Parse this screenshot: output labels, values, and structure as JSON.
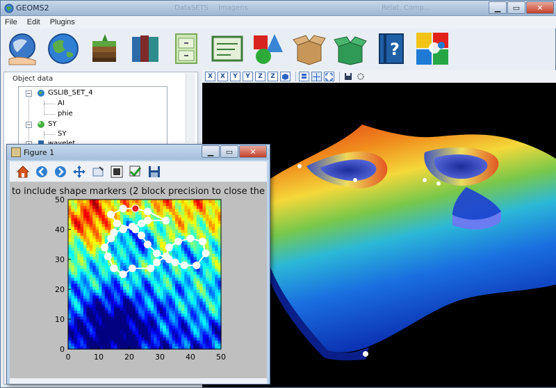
{
  "app": {
    "title": "GEOMS2",
    "ghost_tabs": [
      "DataSETS",
      "Imagens",
      "Relat. Comp..."
    ]
  },
  "menu": [
    "File",
    "Edit",
    "Plugins"
  ],
  "toolbar_icons": [
    "world-hand-icon",
    "globe-icon",
    "layers-icon",
    "books-icon",
    "cabinet-icon",
    "board-icon",
    "shapes-icon",
    "box-open-icon",
    "box-green-icon",
    "help-book-icon",
    "puzzle-icon"
  ],
  "left_panel": {
    "title": "Object data",
    "tree": [
      {
        "label": "GSLIB_SET_4",
        "level": 0,
        "expander": "-"
      },
      {
        "label": "AI",
        "level": 1
      },
      {
        "label": "phie",
        "level": 1
      },
      {
        "label": "SY",
        "level": 0,
        "expander": "-"
      },
      {
        "label": "SY",
        "level": 1
      },
      {
        "label": "wavelet",
        "level": 0,
        "expander": "+"
      }
    ]
  },
  "viewer_toolbar": {
    "buttons": [
      "X",
      "X",
      "Y",
      "Y",
      "Z",
      "Z"
    ]
  },
  "figure": {
    "title": "Figure 1",
    "plot_title": "to include shape markers (2 block precision to close the"
  },
  "chart_data": {
    "type": "heatmap",
    "title": "to include shape markers (2 block precision to close the",
    "xlim": [
      0,
      50
    ],
    "ylim": [
      0,
      50
    ],
    "xticks": [
      0,
      10,
      20,
      30,
      40,
      50
    ],
    "yticks": [
      0,
      10,
      20,
      30,
      40,
      50
    ],
    "colormap": "jet",
    "series": [
      {
        "type": "line-with-markers",
        "marker_color": "#ffffff",
        "points": [
          [
            14,
            45
          ],
          [
            18,
            47
          ],
          [
            22,
            47
          ],
          [
            26,
            46
          ],
          [
            32,
            43
          ],
          [
            26,
            43
          ],
          [
            24,
            42
          ],
          [
            21,
            41
          ],
          [
            18,
            40
          ],
          [
            15,
            39
          ],
          [
            14,
            37
          ],
          [
            12,
            34
          ],
          [
            13,
            31
          ],
          [
            15,
            27
          ],
          [
            18,
            25
          ],
          [
            21,
            27
          ],
          [
            27,
            27
          ],
          [
            29,
            29
          ],
          [
            32,
            31
          ],
          [
            33,
            34
          ],
          [
            36,
            36
          ],
          [
            40,
            37
          ],
          [
            44,
            36
          ],
          [
            45,
            32
          ],
          [
            42,
            28
          ],
          [
            38,
            28
          ],
          [
            35,
            29
          ],
          [
            33,
            30
          ],
          [
            29,
            32
          ],
          [
            26,
            35
          ],
          [
            24,
            38
          ],
          [
            22,
            40
          ],
          [
            16,
            42
          ],
          [
            14,
            45
          ]
        ]
      }
    ],
    "selected_marker": [
      22,
      47
    ],
    "selected_marker_color": "#e8222a"
  },
  "colors": {
    "viewer_bg": "#000000",
    "plot_bg": "#bfbfbf"
  }
}
